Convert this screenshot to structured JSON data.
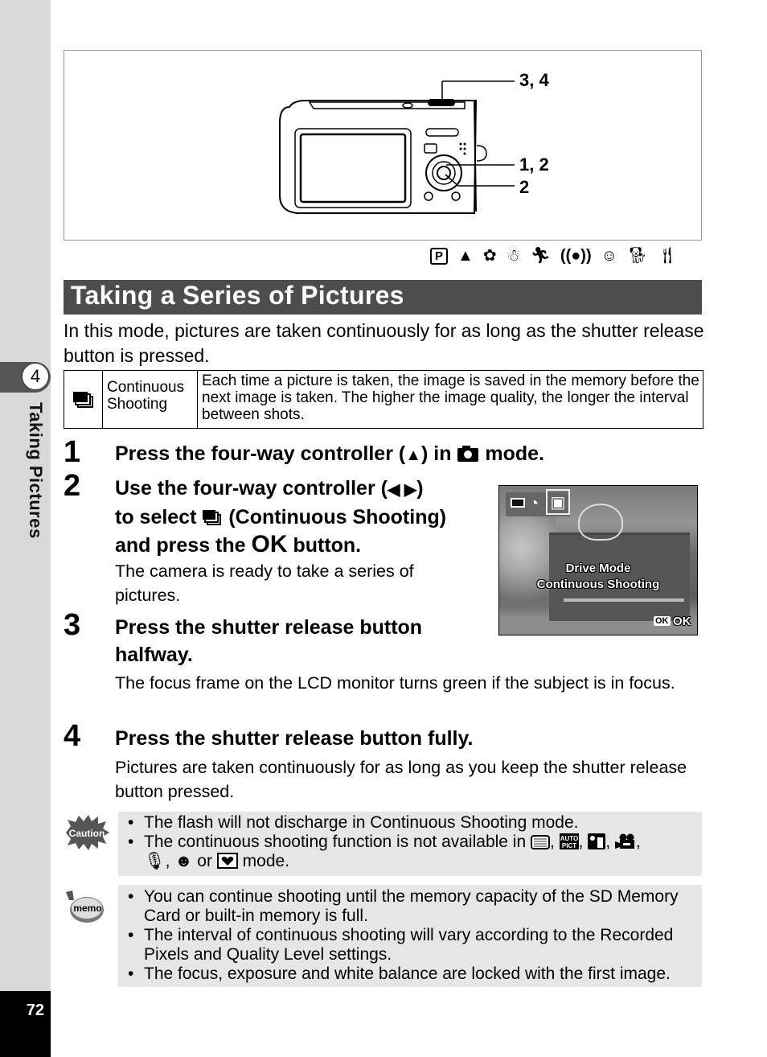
{
  "sidebar": {
    "chapter_number": "4",
    "chapter_title": "Taking Pictures",
    "page_number": "72"
  },
  "figure": {
    "callouts": [
      "3, 4",
      "1, 2",
      "2"
    ]
  },
  "mode_icons": [
    "program-icon",
    "landscape-icon",
    "flower-icon",
    "snow-icon",
    "sport-icon",
    "digital-sr-icon",
    "kids-icon",
    "pet-icon",
    "food-icon"
  ],
  "section": {
    "title": "Taking a Series of Pictures",
    "intro": "In this mode, pictures are taken continuously for as long as the shutter release button is pressed."
  },
  "mode_table": {
    "icon": "continuous-shooting-icon",
    "name_line1": "Continuous",
    "name_line2": "Shooting",
    "description": "Each time a picture is taken, the image is saved in the memory before the next image is taken. The higher the image quality, the longer the interval between shots."
  },
  "steps": [
    {
      "number": "1",
      "title_a": "Press the four-way controller (",
      "title_arrow": "▲",
      "title_b": ") in ",
      "title_c": " mode."
    },
    {
      "number": "2",
      "line1_a": "Use the four-way controller (",
      "line1_arrows": "◀ ▶",
      "line1_b": ")",
      "line2_a": "to select ",
      "line2_b": " (Continuous Shooting)",
      "line3_a": "and press the ",
      "line3_ok": "OK",
      "line3_b": " button.",
      "body": "The camera is ready to take a series of pictures."
    },
    {
      "number": "3",
      "title": "Press the shutter release button halfway.",
      "body": "The focus frame on the LCD monitor turns green if the subject is in focus."
    },
    {
      "number": "4",
      "title": "Press the shutter release button fully.",
      "body": "Pictures are taken continuously for as long as you keep the shutter release button pressed."
    }
  ],
  "lcd": {
    "menu_title": "Drive Mode",
    "selected_option": "Continuous Shooting",
    "ok_badge": "OK",
    "ok_label": "OK"
  },
  "caution": {
    "label": "Caution",
    "items": [
      "The flash will not discharge in Continuous Shooting mode.",
      "The continuous shooting function is not available in"
    ],
    "item2_suffix": "mode.",
    "item2_icons": [
      "frame-composite-icon",
      "auto-picture-icon",
      "night-scene-icon",
      "movie-icon",
      "voice-recording-icon",
      "portrait-icon",
      "frame-icon"
    ],
    "or_word": "or"
  },
  "memo": {
    "label": "memo",
    "items": [
      "You can continue shooting until the memory capacity of the SD Memory Card or built-in memory is full.",
      "The interval of continuous shooting will vary according to the Recorded Pixels and Quality Level settings.",
      "The focus, exposure and white balance are locked with the first image."
    ]
  }
}
